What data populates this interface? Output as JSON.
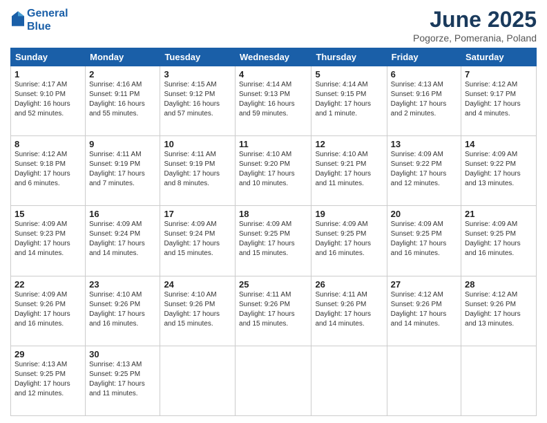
{
  "header": {
    "logo_line1": "General",
    "logo_line2": "Blue",
    "month_title": "June 2025",
    "location": "Pogorze, Pomerania, Poland"
  },
  "weekdays": [
    "Sunday",
    "Monday",
    "Tuesday",
    "Wednesday",
    "Thursday",
    "Friday",
    "Saturday"
  ],
  "weeks": [
    [
      {
        "day": "1",
        "info": "Sunrise: 4:17 AM\nSunset: 9:10 PM\nDaylight: 16 hours\nand 52 minutes."
      },
      {
        "day": "2",
        "info": "Sunrise: 4:16 AM\nSunset: 9:11 PM\nDaylight: 16 hours\nand 55 minutes."
      },
      {
        "day": "3",
        "info": "Sunrise: 4:15 AM\nSunset: 9:12 PM\nDaylight: 16 hours\nand 57 minutes."
      },
      {
        "day": "4",
        "info": "Sunrise: 4:14 AM\nSunset: 9:13 PM\nDaylight: 16 hours\nand 59 minutes."
      },
      {
        "day": "5",
        "info": "Sunrise: 4:14 AM\nSunset: 9:15 PM\nDaylight: 17 hours\nand 1 minute."
      },
      {
        "day": "6",
        "info": "Sunrise: 4:13 AM\nSunset: 9:16 PM\nDaylight: 17 hours\nand 2 minutes."
      },
      {
        "day": "7",
        "info": "Sunrise: 4:12 AM\nSunset: 9:17 PM\nDaylight: 17 hours\nand 4 minutes."
      }
    ],
    [
      {
        "day": "8",
        "info": "Sunrise: 4:12 AM\nSunset: 9:18 PM\nDaylight: 17 hours\nand 6 minutes."
      },
      {
        "day": "9",
        "info": "Sunrise: 4:11 AM\nSunset: 9:19 PM\nDaylight: 17 hours\nand 7 minutes."
      },
      {
        "day": "10",
        "info": "Sunrise: 4:11 AM\nSunset: 9:19 PM\nDaylight: 17 hours\nand 8 minutes."
      },
      {
        "day": "11",
        "info": "Sunrise: 4:10 AM\nSunset: 9:20 PM\nDaylight: 17 hours\nand 10 minutes."
      },
      {
        "day": "12",
        "info": "Sunrise: 4:10 AM\nSunset: 9:21 PM\nDaylight: 17 hours\nand 11 minutes."
      },
      {
        "day": "13",
        "info": "Sunrise: 4:09 AM\nSunset: 9:22 PM\nDaylight: 17 hours\nand 12 minutes."
      },
      {
        "day": "14",
        "info": "Sunrise: 4:09 AM\nSunset: 9:22 PM\nDaylight: 17 hours\nand 13 minutes."
      }
    ],
    [
      {
        "day": "15",
        "info": "Sunrise: 4:09 AM\nSunset: 9:23 PM\nDaylight: 17 hours\nand 14 minutes."
      },
      {
        "day": "16",
        "info": "Sunrise: 4:09 AM\nSunset: 9:24 PM\nDaylight: 17 hours\nand 14 minutes."
      },
      {
        "day": "17",
        "info": "Sunrise: 4:09 AM\nSunset: 9:24 PM\nDaylight: 17 hours\nand 15 minutes."
      },
      {
        "day": "18",
        "info": "Sunrise: 4:09 AM\nSunset: 9:25 PM\nDaylight: 17 hours\nand 15 minutes."
      },
      {
        "day": "19",
        "info": "Sunrise: 4:09 AM\nSunset: 9:25 PM\nDaylight: 17 hours\nand 16 minutes."
      },
      {
        "day": "20",
        "info": "Sunrise: 4:09 AM\nSunset: 9:25 PM\nDaylight: 17 hours\nand 16 minutes."
      },
      {
        "day": "21",
        "info": "Sunrise: 4:09 AM\nSunset: 9:25 PM\nDaylight: 17 hours\nand 16 minutes."
      }
    ],
    [
      {
        "day": "22",
        "info": "Sunrise: 4:09 AM\nSunset: 9:26 PM\nDaylight: 17 hours\nand 16 minutes."
      },
      {
        "day": "23",
        "info": "Sunrise: 4:10 AM\nSunset: 9:26 PM\nDaylight: 17 hours\nand 16 minutes."
      },
      {
        "day": "24",
        "info": "Sunrise: 4:10 AM\nSunset: 9:26 PM\nDaylight: 17 hours\nand 15 minutes."
      },
      {
        "day": "25",
        "info": "Sunrise: 4:11 AM\nSunset: 9:26 PM\nDaylight: 17 hours\nand 15 minutes."
      },
      {
        "day": "26",
        "info": "Sunrise: 4:11 AM\nSunset: 9:26 PM\nDaylight: 17 hours\nand 14 minutes."
      },
      {
        "day": "27",
        "info": "Sunrise: 4:12 AM\nSunset: 9:26 PM\nDaylight: 17 hours\nand 14 minutes."
      },
      {
        "day": "28",
        "info": "Sunrise: 4:12 AM\nSunset: 9:26 PM\nDaylight: 17 hours\nand 13 minutes."
      }
    ],
    [
      {
        "day": "29",
        "info": "Sunrise: 4:13 AM\nSunset: 9:25 PM\nDaylight: 17 hours\nand 12 minutes."
      },
      {
        "day": "30",
        "info": "Sunrise: 4:13 AM\nSunset: 9:25 PM\nDaylight: 17 hours\nand 11 minutes."
      },
      {
        "day": "",
        "info": ""
      },
      {
        "day": "",
        "info": ""
      },
      {
        "day": "",
        "info": ""
      },
      {
        "day": "",
        "info": ""
      },
      {
        "day": "",
        "info": ""
      }
    ]
  ]
}
